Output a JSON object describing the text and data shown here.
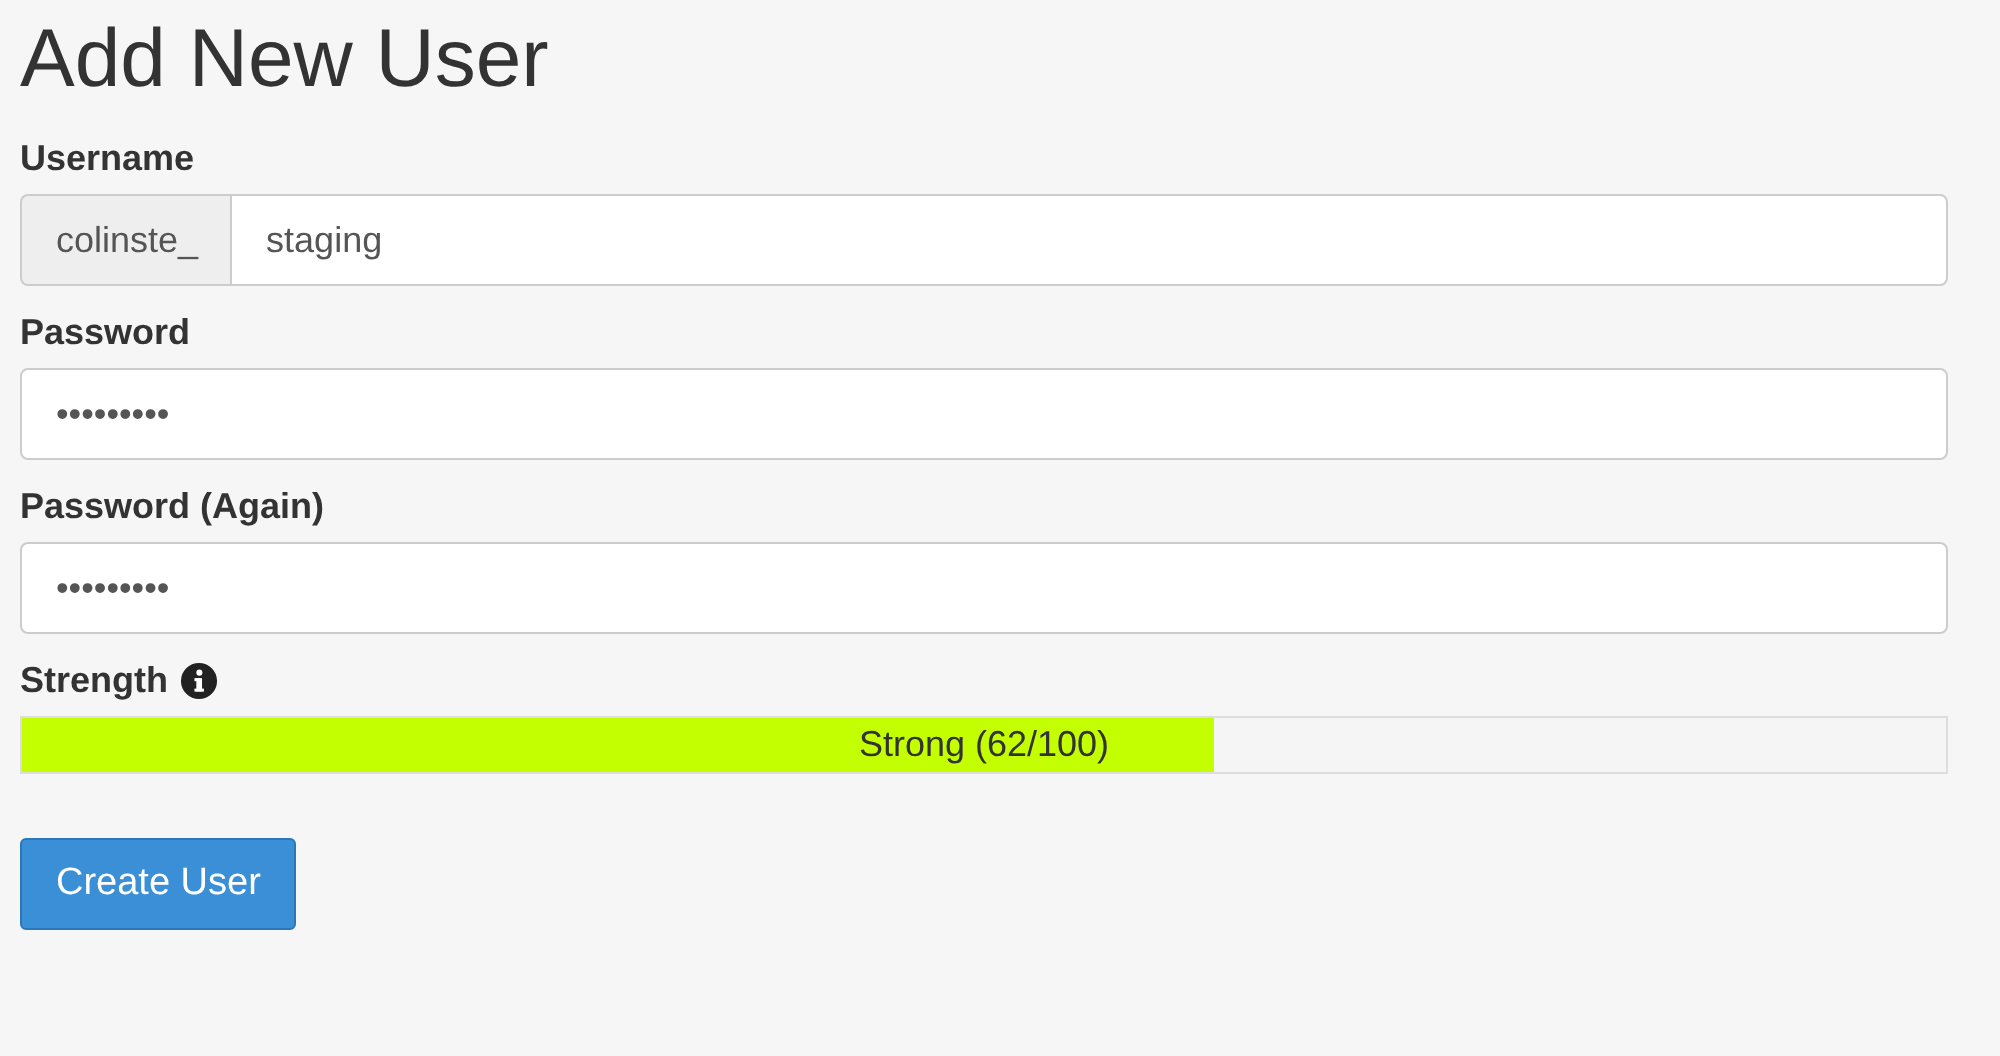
{
  "title": "Add New User",
  "fields": [
    {
      "kind": "prefixed",
      "label": "Username",
      "prefix": "colinste_",
      "value": "staging"
    },
    {
      "kind": "password",
      "label": "Password",
      "value": "•••••••••"
    },
    {
      "kind": "password",
      "label": "Password (Again)",
      "value": "•••••••••"
    }
  ],
  "strength": {
    "label": "Strength",
    "level": 0.62,
    "reading": "Strong (62/100)"
  },
  "button": "Create User"
}
